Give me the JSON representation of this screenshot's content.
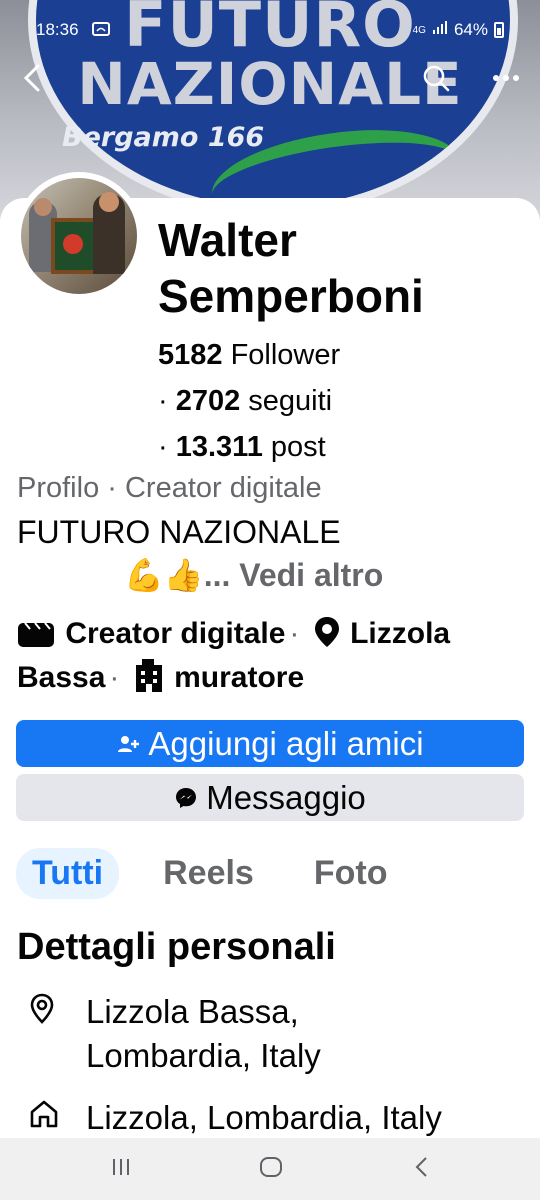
{
  "status_bar": {
    "time": "18:36",
    "network": "4G",
    "battery": "64%"
  },
  "cover": {
    "title_line1": "FUTURO",
    "title_line2": "NAZIONALE",
    "subtitle": "Bergamo 166"
  },
  "profile": {
    "name": "Walter Semperboni",
    "followers_count": "5182",
    "followers_label": "Follower",
    "following_count": "2702",
    "following_label": "seguiti",
    "posts_count": "13.311",
    "posts_label": "post",
    "category_line": "Profilo · Creator digitale",
    "bio": "FUTURO NAZIONALE",
    "bio_emoji": "💪👍",
    "see_more": "... Vedi altro",
    "meta_category": "Creator digitale",
    "meta_location": "Lizzola Bassa",
    "meta_job": "muratore"
  },
  "actions": {
    "add_friend": "Aggiungi agli amici",
    "message": "Messaggio"
  },
  "tabs": [
    {
      "label": "Tutti",
      "active": true
    },
    {
      "label": "Reels",
      "active": false
    },
    {
      "label": "Foto",
      "active": false
    }
  ],
  "details": {
    "title": "Dettagli personali",
    "items": [
      {
        "icon": "location-pin-icon",
        "text_line1": "Lizzola Bassa,",
        "text_line2": "Lombardia, Italy"
      },
      {
        "icon": "home-icon",
        "text_line1": "Lizzola, Lombardia, Italy"
      }
    ]
  },
  "colors": {
    "accent": "#1877f2",
    "secondary_button": "#e4e6eb",
    "muted_text": "#65676b",
    "cover_blue": "#1a3f93"
  }
}
